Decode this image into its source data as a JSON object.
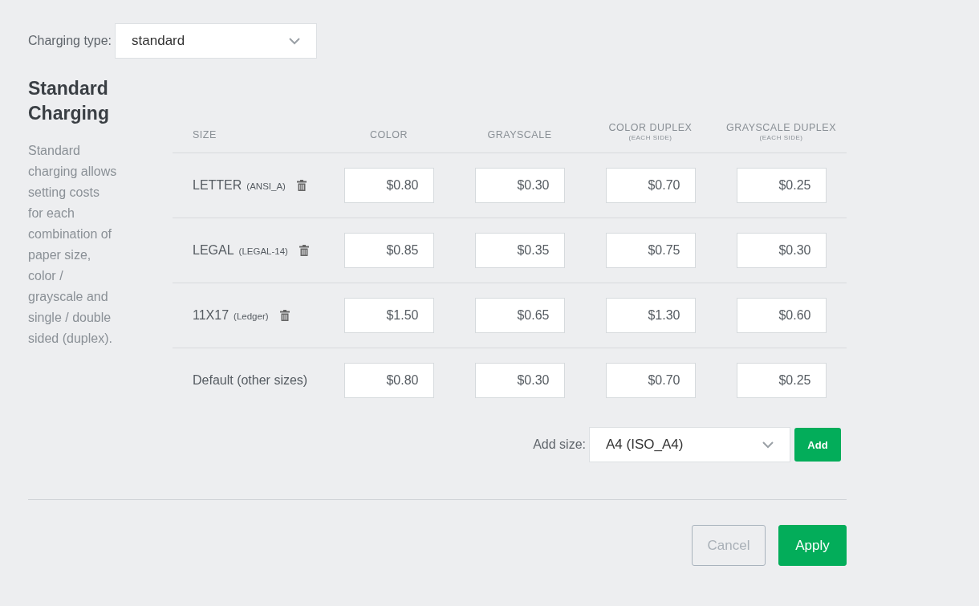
{
  "charging_type": {
    "label": "Charging type:",
    "value": "standard"
  },
  "section": {
    "title": "Standard Charging",
    "description": "Standard charging allows setting costs for each combination of paper size, color / grayscale and single / double sided (duplex)."
  },
  "table": {
    "columns": [
      {
        "label": "SIZE"
      },
      {
        "label": "COLOR"
      },
      {
        "label": "GRAYSCALE"
      },
      {
        "label": "COLOR DUPLEX",
        "note": "(EACH SIDE)"
      },
      {
        "label": "GRAYSCALE DUPLEX",
        "note": "(EACH SIDE)"
      }
    ],
    "rows": [
      {
        "size": "LETTER",
        "code": "(ANSI_A)",
        "removable": true,
        "prices": [
          "$0.80",
          "$0.30",
          "$0.70",
          "$0.25"
        ]
      },
      {
        "size": "LEGAL",
        "code": "(LEGAL-14)",
        "removable": true,
        "prices": [
          "$0.85",
          "$0.35",
          "$0.75",
          "$0.30"
        ]
      },
      {
        "size": "11X17",
        "code": "(Ledger)",
        "removable": true,
        "prices": [
          "$1.50",
          "$0.65",
          "$1.30",
          "$0.60"
        ]
      },
      {
        "size": "Default (other sizes)",
        "removable": false,
        "prices": [
          "$0.80",
          "$0.30",
          "$0.70",
          "$0.25"
        ]
      }
    ]
  },
  "add_size": {
    "label": "Add size:",
    "value": "A4 (ISO_A4)",
    "button": "Add"
  },
  "buttons": [
    {
      "label": "Cancel",
      "kind": "secondary",
      "disabled": true
    },
    {
      "label": "Apply",
      "kind": "primary",
      "disabled": false
    }
  ]
}
